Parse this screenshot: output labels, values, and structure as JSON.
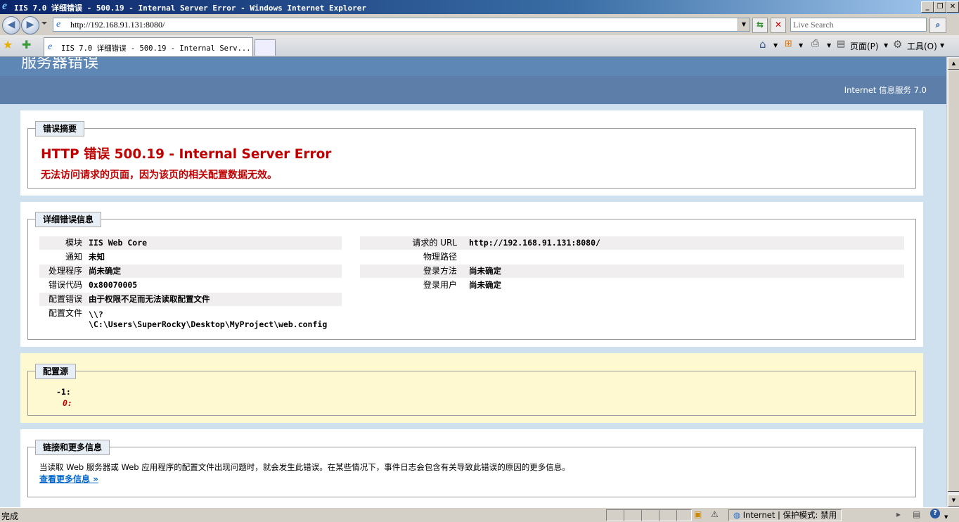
{
  "window": {
    "title": "IIS 7.0 详细错误 - 500.19 - Internal Server Error - Windows Internet Explorer"
  },
  "navbar": {
    "url": "http://192.168.91.131:8080/",
    "search_placeholder": "Live Search"
  },
  "tabs": [
    {
      "label": "IIS 7.0 详细错误 - 500.19 - Internal Serv..."
    }
  ],
  "commands": {
    "page_label": "页面(P)",
    "tools_label": "工具(O)"
  },
  "page": {
    "header_title": "服务器错误",
    "header_right": "Internet 信息服务 7.0",
    "summary": {
      "legend": "错误摘要",
      "heading": "HTTP 错误 500.19 - Internal Server Error",
      "message": "无法访问请求的页面，因为该页的相关配置数据无效。"
    },
    "details": {
      "legend": "详细错误信息",
      "left_rows": [
        {
          "label": "模块",
          "value": "IIS Web Core"
        },
        {
          "label": "通知",
          "value": "未知"
        },
        {
          "label": "处理程序",
          "value": "尚未确定"
        },
        {
          "label": "错误代码",
          "value": "0x80070005"
        },
        {
          "label": "配置错误",
          "value": "由于权限不足而无法读取配置文件"
        },
        {
          "label": "配置文件",
          "value": "\\\\?",
          "value2": "\\C:\\Users\\SuperRocky\\Desktop\\MyProject\\web.config"
        }
      ],
      "right_rows": [
        {
          "label": "请求的 URL",
          "value": "http://192.168.91.131:8080/"
        },
        {
          "label": "物理路径",
          "value": ""
        },
        {
          "label": "登录方法",
          "value": "尚未确定"
        },
        {
          "label": "登录用户",
          "value": "尚未确定"
        }
      ]
    },
    "config_source": {
      "legend": "配置源",
      "line1": "-1:",
      "line2": "0:"
    },
    "links": {
      "legend": "链接和更多信息",
      "text": "当读取 Web 服务器或 Web 应用程序的配置文件出现问题时，就会发生此错误。在某些情况下，事件日志会包含有关导致此错误的原因的更多信息。",
      "more_link": "查看更多信息 »"
    }
  },
  "status": {
    "left": "完成",
    "zone": "Internet | 保护模式: 禁用"
  },
  "colors": {
    "error_red": "#c00000",
    "header_blue": "#5e87b6",
    "link_blue": "#0066cc"
  }
}
